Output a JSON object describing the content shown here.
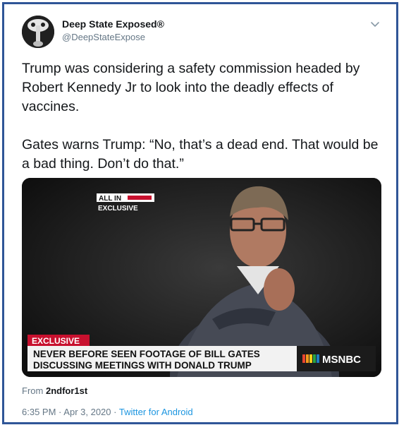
{
  "account": {
    "display_name": "Deep State Exposed",
    "verified_mark": "®",
    "handle": "@DeepStateExpose",
    "avatar_icon": "skull-avatar-icon"
  },
  "tweet": {
    "paragraphs": [
      "Trump was considering a safety commission headed by Robert Kennedy Jr to look into the deadly effects of vaccines.",
      "Gates warns Trump: “No, that’s a dead end. That would be a bad thing. Don’t do that.”"
    ]
  },
  "video": {
    "logo_top_text": "ALL IN",
    "logo_exclusive": "EXCLUSIVE",
    "lower_third_tag": "EXCLUSIVE",
    "headline_line1": "NEVER BEFORE SEEN FOOTAGE OF BILL GATES",
    "headline_line2": "DISCUSSING MEETINGS WITH DONALD TRUMP",
    "network": "MSNBC"
  },
  "attribution": {
    "from_label": "From",
    "source_user": "2ndfor1st"
  },
  "meta": {
    "time": "6:35 PM",
    "separator": "·",
    "date": "Apr 3, 2020",
    "client": "Twitter for Android"
  },
  "colors": {
    "frame_border": "#2f5597",
    "link_blue": "#1b95e0",
    "muted_gray": "#657786",
    "banner_red": "#c8102e"
  }
}
